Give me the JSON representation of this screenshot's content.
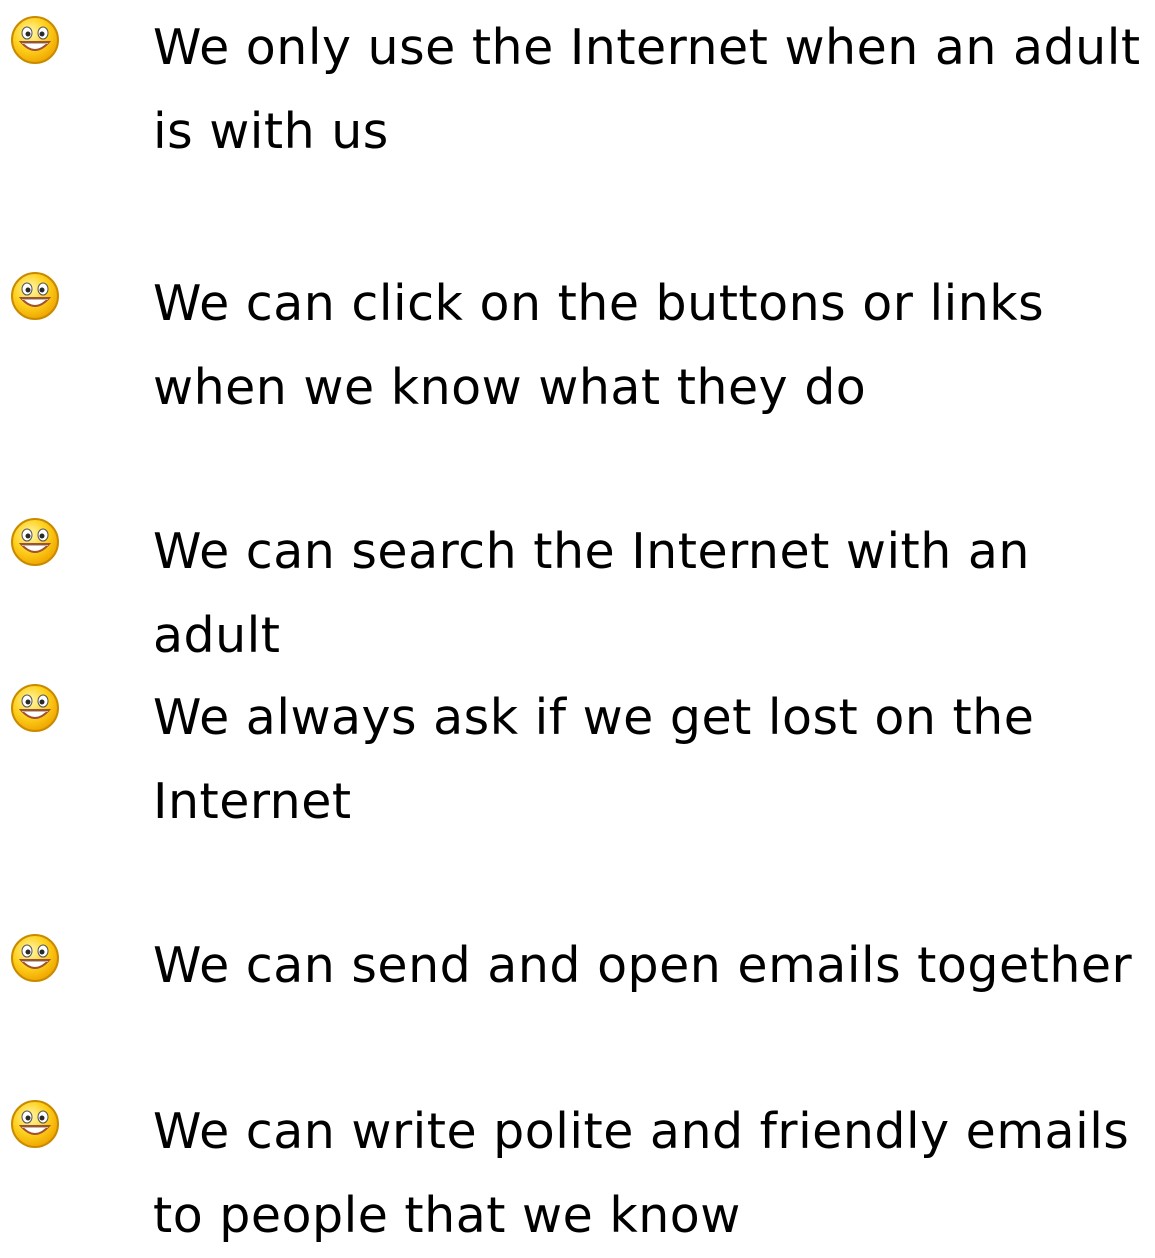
{
  "rules": [
    {
      "text": "We only use the Internet when an adult is with us",
      "icon": "smiley-icon"
    },
    {
      "text": "We can click on the buttons or links when we know what they do",
      "icon": "smiley-icon"
    },
    {
      "text": "We can search the Internet with an adult",
      "icon": "smiley-icon"
    },
    {
      "text": "We always ask if we get lost on the Internet",
      "icon": "smiley-icon"
    },
    {
      "text": "We can send and open emails together",
      "icon": "smiley-icon"
    },
    {
      "text": "We can write polite and friendly emails to people that we know",
      "icon": "smiley-icon"
    }
  ],
  "colors": {
    "smiley_face": "#ffd21f",
    "smiley_outline": "#c98a00",
    "text": "#000000"
  }
}
